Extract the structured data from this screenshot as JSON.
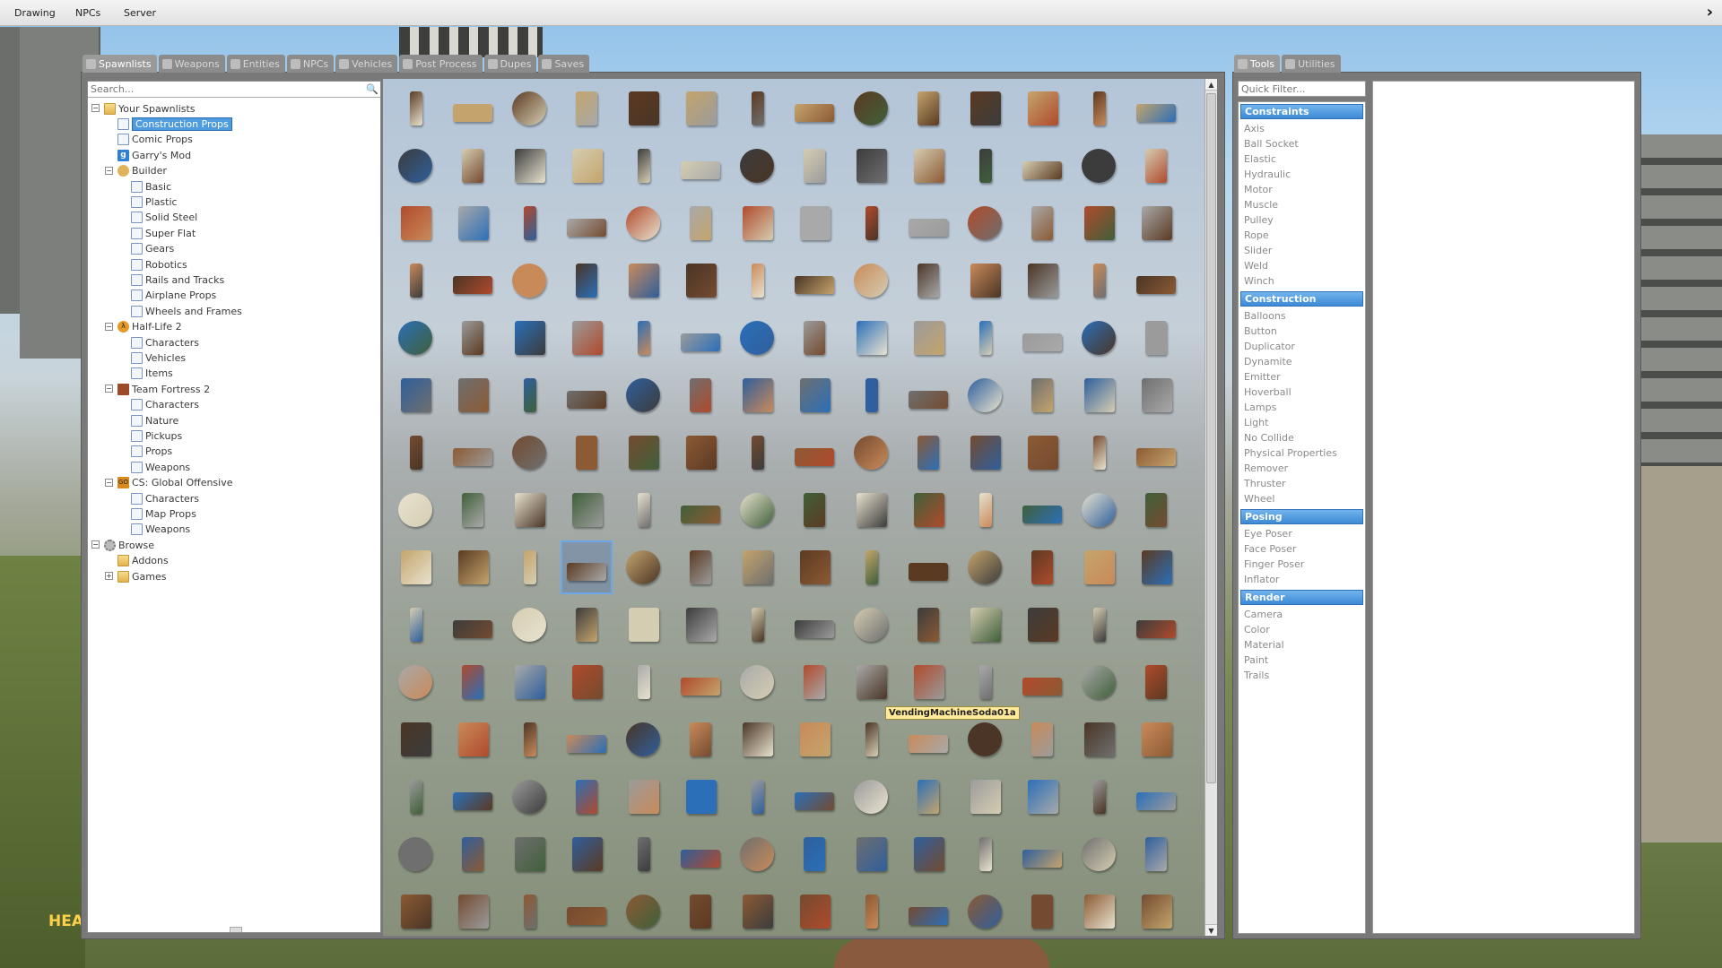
{
  "background": {
    "hud_text": "HEA"
  },
  "topbar": {
    "menu": [
      "Drawing",
      "NPCs",
      "Server"
    ],
    "arrow": "›"
  },
  "spawnmenu": {
    "tabs": [
      {
        "label": "Spawnlists",
        "icon": "spawnlists-icon",
        "active": true
      },
      {
        "label": "Weapons",
        "icon": "weapons-icon",
        "active": false
      },
      {
        "label": "Entities",
        "icon": "entities-icon",
        "active": false
      },
      {
        "label": "NPCs",
        "icon": "npcs-icon",
        "active": false
      },
      {
        "label": "Vehicles",
        "icon": "vehicles-icon",
        "active": false
      },
      {
        "label": "Post Process",
        "icon": "post-process-icon",
        "active": false
      },
      {
        "label": "Dupes",
        "icon": "dupes-icon",
        "active": false
      },
      {
        "label": "Saves",
        "icon": "saves-icon",
        "active": false
      }
    ],
    "search_placeholder": "Search...",
    "tree": [
      {
        "label": "Your Spawnlists",
        "icon": "folder",
        "depth": 0,
        "toggle": "−"
      },
      {
        "label": "Construction Props",
        "icon": "page",
        "depth": 1,
        "selected": true
      },
      {
        "label": "Comic Props",
        "icon": "page",
        "depth": 1
      },
      {
        "label": "Garry's Mod",
        "icon": "gm",
        "depth": 1
      },
      {
        "label": "Builder",
        "icon": "build",
        "depth": 1,
        "toggle": "−"
      },
      {
        "label": "Basic",
        "icon": "page",
        "depth": 2
      },
      {
        "label": "Plastic",
        "icon": "page",
        "depth": 2
      },
      {
        "label": "Solid Steel",
        "icon": "page",
        "depth": 2
      },
      {
        "label": "Super Flat",
        "icon": "page",
        "depth": 2
      },
      {
        "label": "Gears",
        "icon": "page",
        "depth": 2
      },
      {
        "label": "Robotics",
        "icon": "page",
        "depth": 2
      },
      {
        "label": "Rails and Tracks",
        "icon": "page",
        "depth": 2
      },
      {
        "label": "Airplane Props",
        "icon": "page",
        "depth": 2
      },
      {
        "label": "Wheels and Frames",
        "icon": "page",
        "depth": 2
      },
      {
        "label": "Half-Life 2",
        "icon": "hl",
        "depth": 1,
        "toggle": "−"
      },
      {
        "label": "Characters",
        "icon": "page",
        "depth": 2
      },
      {
        "label": "Vehicles",
        "icon": "page",
        "depth": 2
      },
      {
        "label": "Items",
        "icon": "page",
        "depth": 2
      },
      {
        "label": "Team Fortress 2",
        "icon": "tf",
        "depth": 1,
        "toggle": "−"
      },
      {
        "label": "Characters",
        "icon": "page",
        "depth": 2
      },
      {
        "label": "Nature",
        "icon": "page",
        "depth": 2
      },
      {
        "label": "Pickups",
        "icon": "page",
        "depth": 2
      },
      {
        "label": "Props",
        "icon": "page",
        "depth": 2
      },
      {
        "label": "Weapons",
        "icon": "page",
        "depth": 2
      },
      {
        "label": "CS: Global Offensive",
        "icon": "cs",
        "depth": 1,
        "toggle": "−"
      },
      {
        "label": "Characters",
        "icon": "page",
        "depth": 2
      },
      {
        "label": "Map Props",
        "icon": "page",
        "depth": 2
      },
      {
        "label": "Weapons",
        "icon": "page",
        "depth": 2
      },
      {
        "label": "Browse",
        "icon": "gear",
        "depth": 0,
        "toggle": "−"
      },
      {
        "label": "Addons",
        "icon": "folder",
        "depth": 1
      },
      {
        "label": "Games",
        "icon": "folder",
        "depth": 1,
        "toggle": "+"
      }
    ],
    "tooltip": "VendingMachineSoda01a",
    "grid": {
      "columns": 14,
      "rows": 15,
      "selected_index": 115
    },
    "palette": [
      "#5b3a22",
      "#6f6f6f",
      "#a9a9a9",
      "#e8e2cf",
      "#2b6fb8",
      "#3c3c3c",
      "#8c5a34",
      "#4a3526",
      "#c4a46c",
      "#2f5f9c",
      "#b04a2c",
      "#40603a",
      "#9b9b9b",
      "#d5cdb2",
      "#744b30",
      "#c98a5a"
    ]
  },
  "tools": {
    "tabs": [
      {
        "label": "Tools",
        "icon": "tools-icon",
        "active": true
      },
      {
        "label": "Utilities",
        "icon": "utilities-icon",
        "active": false
      }
    ],
    "filter_placeholder": "Quick Filter...",
    "categories": [
      {
        "name": "Constraints",
        "items": [
          "Axis",
          "Ball Socket",
          "Elastic",
          "Hydraulic",
          "Motor",
          "Muscle",
          "Pulley",
          "Rope",
          "Slider",
          "Weld",
          "Winch"
        ]
      },
      {
        "name": "Construction",
        "items": [
          "Balloons",
          "Button",
          "Duplicator",
          "Dynamite",
          "Emitter",
          "Hoverball",
          "Lamps",
          "Light",
          "No Collide",
          "Physical Properties",
          "Remover",
          "Thruster",
          "Wheel"
        ]
      },
      {
        "name": "Posing",
        "items": [
          "Eye Poser",
          "Face Poser",
          "Finger Poser",
          "Inflator"
        ]
      },
      {
        "name": "Render",
        "items": [
          "Camera",
          "Color",
          "Material",
          "Paint",
          "Trails"
        ]
      }
    ]
  }
}
